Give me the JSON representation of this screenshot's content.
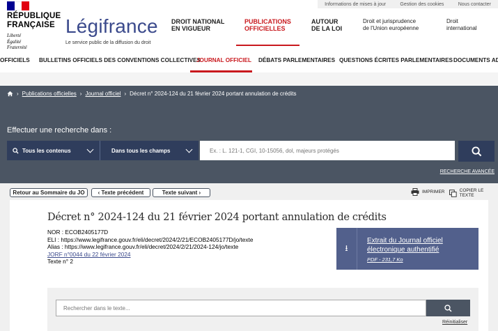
{
  "top_links": [
    "Informations de mises à jour",
    "Gestion des cookies",
    "Nous contacter"
  ],
  "flag_colors": [
    "#000091",
    "#ffffff",
    "#e1000f"
  ],
  "logo": {
    "line1": "RÉPUBLIQUE",
    "line2": "FRANÇAISE",
    "motto1": "Liberté",
    "motto2": "Égalité",
    "motto3": "Fraternité"
  },
  "brand": {
    "name": "Légifrance",
    "tagline": "Le service public de la diffusion du droit"
  },
  "main_nav": [
    {
      "l1": "DROIT NATIONAL",
      "l2": "EN VIGUEUR"
    },
    {
      "l1": "PUBLICATIONS",
      "l2": "OFFICIELLES"
    },
    {
      "l1": "AUTOUR",
      "l2": "DE LA LOI"
    },
    {
      "l1": "Droit et jurisprudence",
      "l2": "de l'Union européenne"
    },
    {
      "l1": "Droit",
      "l2": "international"
    }
  ],
  "sub_nav": [
    "OFFICIELS",
    "BULLETINS OFFICIELS DES CONVENTIONS COLLECTIVES",
    "JOURNAL OFFICIEL",
    "DÉBATS PARLEMENTAIRES",
    "QUESTIONS ÉCRITES PARLEMENTAIRES",
    "DOCUMENTS ADM"
  ],
  "breadcrumb": {
    "home_icon": "home-icon",
    "b1": "Publications officielles",
    "b2": "Journal officiel",
    "b3": "Décret n° 2024-124 du 21 février 2024 portant annulation de crédits"
  },
  "search": {
    "title": "Effectuer une recherche dans :",
    "scope": "Tous les contenus",
    "field": "Dans tous les champs",
    "placeholder": "Ex. : L. 121-1, CGI, 10-15056, dol, majeurs protégés",
    "advanced": "RECHERCHE AVANCÉE"
  },
  "toolbar": {
    "back": "Retour au Sommaire du JO",
    "prev": "‹ Texte précédent",
    "next": "Texte suivant ›",
    "print": "IMPRIMER",
    "copy": "COPIER LE TEXTE"
  },
  "document": {
    "title": "Décret n° 2024-124 du 21 février 2024 portant annulation de crédits",
    "nor": "NOR : ECOB2405177D",
    "eli": "ELI : https://www.legifrance.gouv.fr/eli/decret/2024/2/21/ECOB2405177D/jo/texte",
    "alias": "Alias : https://www.legifrance.gouv.fr/eli/decret/2024/2/21/2024-124/jo/texte",
    "jorf": "JORF n°0044 du 22 février 2024",
    "texte": "Texte n° 2"
  },
  "jo_extract": {
    "line1": "Extrait du Journal officiel",
    "line2": "électronique authentifié",
    "size": "PDF - 231,7 Ko"
  },
  "text_search": {
    "placeholder": "Rechercher dans le texte...",
    "reset": "Réinitialiser"
  }
}
